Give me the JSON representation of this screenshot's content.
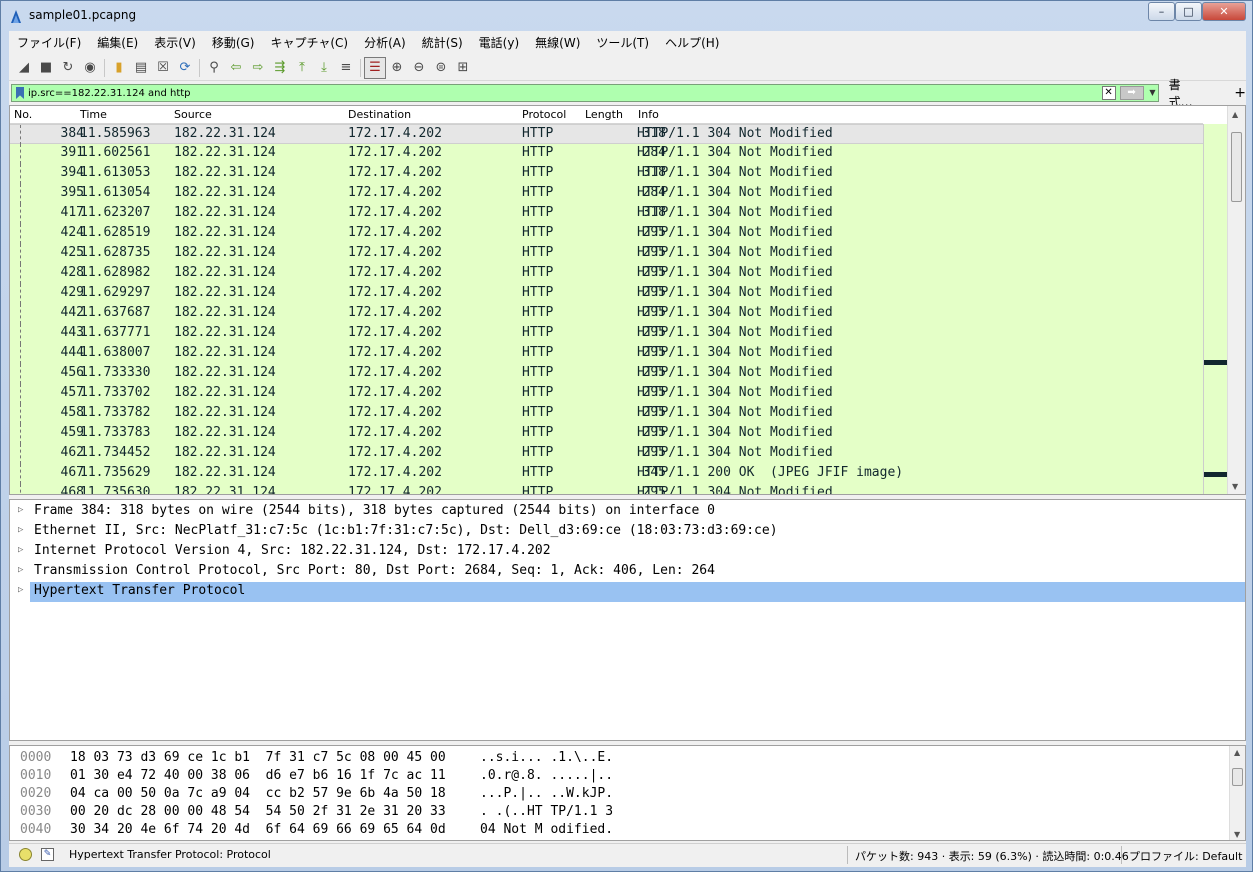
{
  "window": {
    "title": "sample01.pcapng",
    "min": "–",
    "max": "□",
    "close": "✕"
  },
  "menu": [
    "ファイル(F)",
    "編集(E)",
    "表示(V)",
    "移動(G)",
    "キャプチャ(C)",
    "分析(A)",
    "統計(S)",
    "電話(y)",
    "無線(W)",
    "ツール(T)",
    "ヘルプ(H)"
  ],
  "toolbar": {
    "icons": [
      "shark-fin-start-icon",
      "stop-icon",
      "restart-icon",
      "capture-options-icon",
      "open-file-icon",
      "save-file-icon",
      "close-file-icon",
      "reload-icon",
      "find-packet-icon",
      "go-back-icon",
      "go-forward-icon",
      "go-to-packet-icon",
      "first-packet-icon",
      "last-packet-icon",
      "autoscroll-icon",
      "colorize-icon",
      "zoom-in-icon",
      "zoom-out-icon",
      "zoom-normal-icon",
      "resize-columns-icon"
    ]
  },
  "filter": {
    "value": "ip.src==182.22.31.124 and http",
    "expression_label": "書式…",
    "add_label": "+"
  },
  "columns": {
    "no": "No.",
    "time": "Time",
    "source": "Source",
    "destination": "Destination",
    "protocol": "Protocol",
    "length": "Length",
    "info": "Info"
  },
  "packets": [
    {
      "no": "384",
      "time": "11.585963",
      "src": "182.22.31.124",
      "dst": "172.17.4.202",
      "proto": "HTTP",
      "len": "318",
      "info": "HTTP/1.1 304 Not Modified"
    },
    {
      "no": "391",
      "time": "11.602561",
      "src": "182.22.31.124",
      "dst": "172.17.4.202",
      "proto": "HTTP",
      "len": "284",
      "info": "HTTP/1.1 304 Not Modified"
    },
    {
      "no": "394",
      "time": "11.613053",
      "src": "182.22.31.124",
      "dst": "172.17.4.202",
      "proto": "HTTP",
      "len": "318",
      "info": "HTTP/1.1 304 Not Modified"
    },
    {
      "no": "395",
      "time": "11.613054",
      "src": "182.22.31.124",
      "dst": "172.17.4.202",
      "proto": "HTTP",
      "len": "284",
      "info": "HTTP/1.1 304 Not Modified"
    },
    {
      "no": "417",
      "time": "11.623207",
      "src": "182.22.31.124",
      "dst": "172.17.4.202",
      "proto": "HTTP",
      "len": "318",
      "info": "HTTP/1.1 304 Not Modified"
    },
    {
      "no": "424",
      "time": "11.628519",
      "src": "182.22.31.124",
      "dst": "172.17.4.202",
      "proto": "HTTP",
      "len": "295",
      "info": "HTTP/1.1 304 Not Modified"
    },
    {
      "no": "425",
      "time": "11.628735",
      "src": "182.22.31.124",
      "dst": "172.17.4.202",
      "proto": "HTTP",
      "len": "295",
      "info": "HTTP/1.1 304 Not Modified"
    },
    {
      "no": "428",
      "time": "11.628982",
      "src": "182.22.31.124",
      "dst": "172.17.4.202",
      "proto": "HTTP",
      "len": "295",
      "info": "HTTP/1.1 304 Not Modified"
    },
    {
      "no": "429",
      "time": "11.629297",
      "src": "182.22.31.124",
      "dst": "172.17.4.202",
      "proto": "HTTP",
      "len": "295",
      "info": "HTTP/1.1 304 Not Modified"
    },
    {
      "no": "442",
      "time": "11.637687",
      "src": "182.22.31.124",
      "dst": "172.17.4.202",
      "proto": "HTTP",
      "len": "295",
      "info": "HTTP/1.1 304 Not Modified"
    },
    {
      "no": "443",
      "time": "11.637771",
      "src": "182.22.31.124",
      "dst": "172.17.4.202",
      "proto": "HTTP",
      "len": "295",
      "info": "HTTP/1.1 304 Not Modified"
    },
    {
      "no": "444",
      "time": "11.638007",
      "src": "182.22.31.124",
      "dst": "172.17.4.202",
      "proto": "HTTP",
      "len": "295",
      "info": "HTTP/1.1 304 Not Modified"
    },
    {
      "no": "456",
      "time": "11.733330",
      "src": "182.22.31.124",
      "dst": "172.17.4.202",
      "proto": "HTTP",
      "len": "295",
      "info": "HTTP/1.1 304 Not Modified"
    },
    {
      "no": "457",
      "time": "11.733702",
      "src": "182.22.31.124",
      "dst": "172.17.4.202",
      "proto": "HTTP",
      "len": "295",
      "info": "HTTP/1.1 304 Not Modified"
    },
    {
      "no": "458",
      "time": "11.733782",
      "src": "182.22.31.124",
      "dst": "172.17.4.202",
      "proto": "HTTP",
      "len": "295",
      "info": "HTTP/1.1 304 Not Modified"
    },
    {
      "no": "459",
      "time": "11.733783",
      "src": "182.22.31.124",
      "dst": "172.17.4.202",
      "proto": "HTTP",
      "len": "295",
      "info": "HTTP/1.1 304 Not Modified"
    },
    {
      "no": "462",
      "time": "11.734452",
      "src": "182.22.31.124",
      "dst": "172.17.4.202",
      "proto": "HTTP",
      "len": "295",
      "info": "HTTP/1.1 304 Not Modified"
    },
    {
      "no": "467",
      "time": "11.735629",
      "src": "182.22.31.124",
      "dst": "172.17.4.202",
      "proto": "HTTP",
      "len": "345",
      "info": "HTTP/1.1 200 OK  (JPEG JFIF image)"
    },
    {
      "no": "468",
      "time": "11.735630",
      "src": "182.22.31.124",
      "dst": "172.17.4.202",
      "proto": "HTTP",
      "len": "295",
      "info": "HTTP/1.1 304 Not Modified"
    }
  ],
  "details": [
    "Frame 384: 318 bytes on wire (2544 bits), 318 bytes captured (2544 bits) on interface 0",
    "Ethernet II, Src: NecPlatf_31:c7:5c (1c:b1:7f:31:c7:5c), Dst: Dell_d3:69:ce (18:03:73:d3:69:ce)",
    "Internet Protocol Version 4, Src: 182.22.31.124, Dst: 172.17.4.202",
    "Transmission Control Protocol, Src Port: 80, Dst Port: 2684, Seq: 1, Ack: 406, Len: 264",
    "Hypertext Transfer Protocol"
  ],
  "bytes": [
    {
      "off": "0000",
      "hex": "18 03 73 d3 69 ce 1c b1  7f 31 c7 5c 08 00 45 00",
      "ascii": "..s.i... .1.\\..E."
    },
    {
      "off": "0010",
      "hex": "01 30 e4 72 40 00 38 06  d6 e7 b6 16 1f 7c ac 11",
      "ascii": ".0.r@.8. .....|.."
    },
    {
      "off": "0020",
      "hex": "04 ca 00 50 0a 7c a9 04  cc b2 57 9e 6b 4a 50 18",
      "ascii": "...P.|.. ..W.kJP."
    },
    {
      "off": "0030",
      "hex": "00 20 dc 28 00 00 48 54  54 50 2f 31 2e 31 20 33",
      "ascii": ". .(..HT TP/1.1 3"
    },
    {
      "off": "0040",
      "hex": "30 34 20 4e 6f 74 20 4d  6f 64 69 66 69 65 64 0d",
      "ascii": "04 Not M odified."
    }
  ],
  "status": {
    "message": "Hypertext Transfer Protocol: Protocol",
    "counts": "パケット数: 943 · 表示: 59 (6.3%) ·  読込時間: 0:0.46",
    "profile": "プロファイル: Default"
  },
  "colors": {
    "http_row": "#e4ffc7",
    "filter_ok": "#afffaf",
    "selected_detail": "#99c2f2"
  }
}
